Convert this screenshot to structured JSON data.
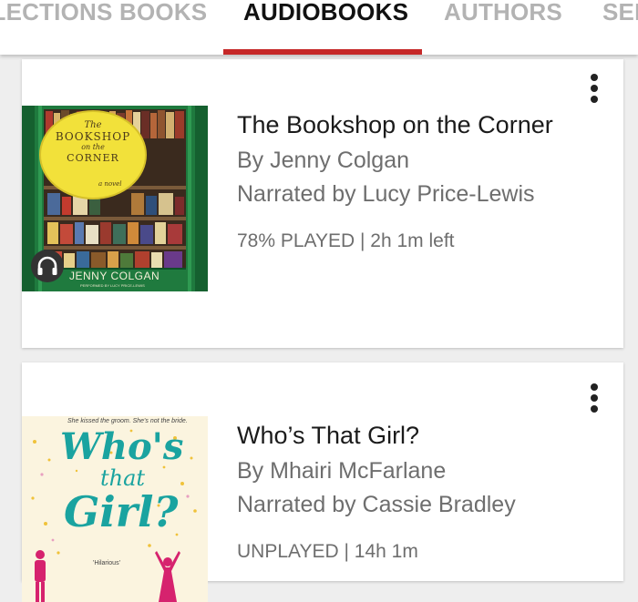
{
  "tabs": [
    {
      "label": "COLLECTIONS",
      "active": false
    },
    {
      "label": "BOOKS",
      "active": false
    },
    {
      "label": "AUDIOBOOKS",
      "active": true
    },
    {
      "label": "AUTHORS",
      "active": false
    },
    {
      "label": "SERIES",
      "active": false
    }
  ],
  "accent_color": "#c62828",
  "books": [
    {
      "title": "The Bookshop on the Corner",
      "author": "By Jenny Colgan",
      "narrator": "Narrated by Lucy Price-Lewis",
      "progress": "78% PLAYED | 2h 1m left",
      "cover": {
        "title_lines": [
          "The",
          "BOOKSHOP",
          "on the",
          "CORNER"
        ],
        "subtitle": "a novel",
        "author": "JENNY COLGAN",
        "narrator": "PERFORMED BY LUCY PRICE-LEWIS"
      },
      "cover_icon": "headphones-icon"
    },
    {
      "title": "Who’s That Girl?",
      "author": "By Mhairi McFarlane",
      "narrator": "Narrated by Cassie Bradley",
      "progress": "UNPLAYED | 14h 1m",
      "cover": {
        "tagline": "She kissed the groom. She's not the bride.",
        "title_lines": [
          "Who's",
          "that",
          "Girl?"
        ],
        "quote": "'Hilarious'"
      }
    }
  ],
  "menu_icon": "more-vert-icon"
}
